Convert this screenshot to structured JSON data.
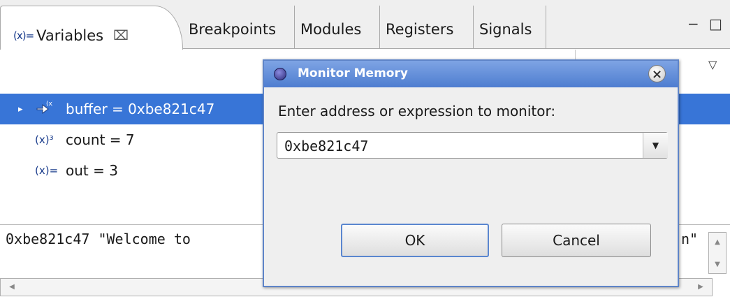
{
  "tabs": {
    "active": {
      "icon": "(x)=",
      "label": "Variables",
      "close": "⌧"
    },
    "others": [
      "Breakpoints",
      "Modules",
      "Registers",
      "Signals"
    ]
  },
  "view_controls": {
    "minimize": "−",
    "maximize": "□",
    "view_menu": "▽"
  },
  "variables": [
    {
      "text": "buffer = 0xbe821c47",
      "icon": "pointer-variable-icon",
      "expander": "▸",
      "selected": true
    },
    {
      "text": "count = 7",
      "icon": "local-variable-icon",
      "icon_glyph": "(x)³",
      "selected": false
    },
    {
      "text": "out = 3",
      "icon": "variable-icon",
      "icon_glyph": "(x)=",
      "selected": false
    }
  ],
  "detail": {
    "text_left": "0xbe821c47 \"Welcome to",
    "text_right": "n\""
  },
  "dialog": {
    "title": "Monitor Memory",
    "prompt": "Enter address or expression to monitor:",
    "address_value": "0xbe821c47",
    "dropdown_arrow": "▼",
    "close_glyph": "×",
    "ok_label": "OK",
    "cancel_label": "Cancel"
  },
  "colors": {
    "selection": "#3875d7",
    "titlebar": "#5b8ad6",
    "default_button_border": "#5a86cf"
  }
}
